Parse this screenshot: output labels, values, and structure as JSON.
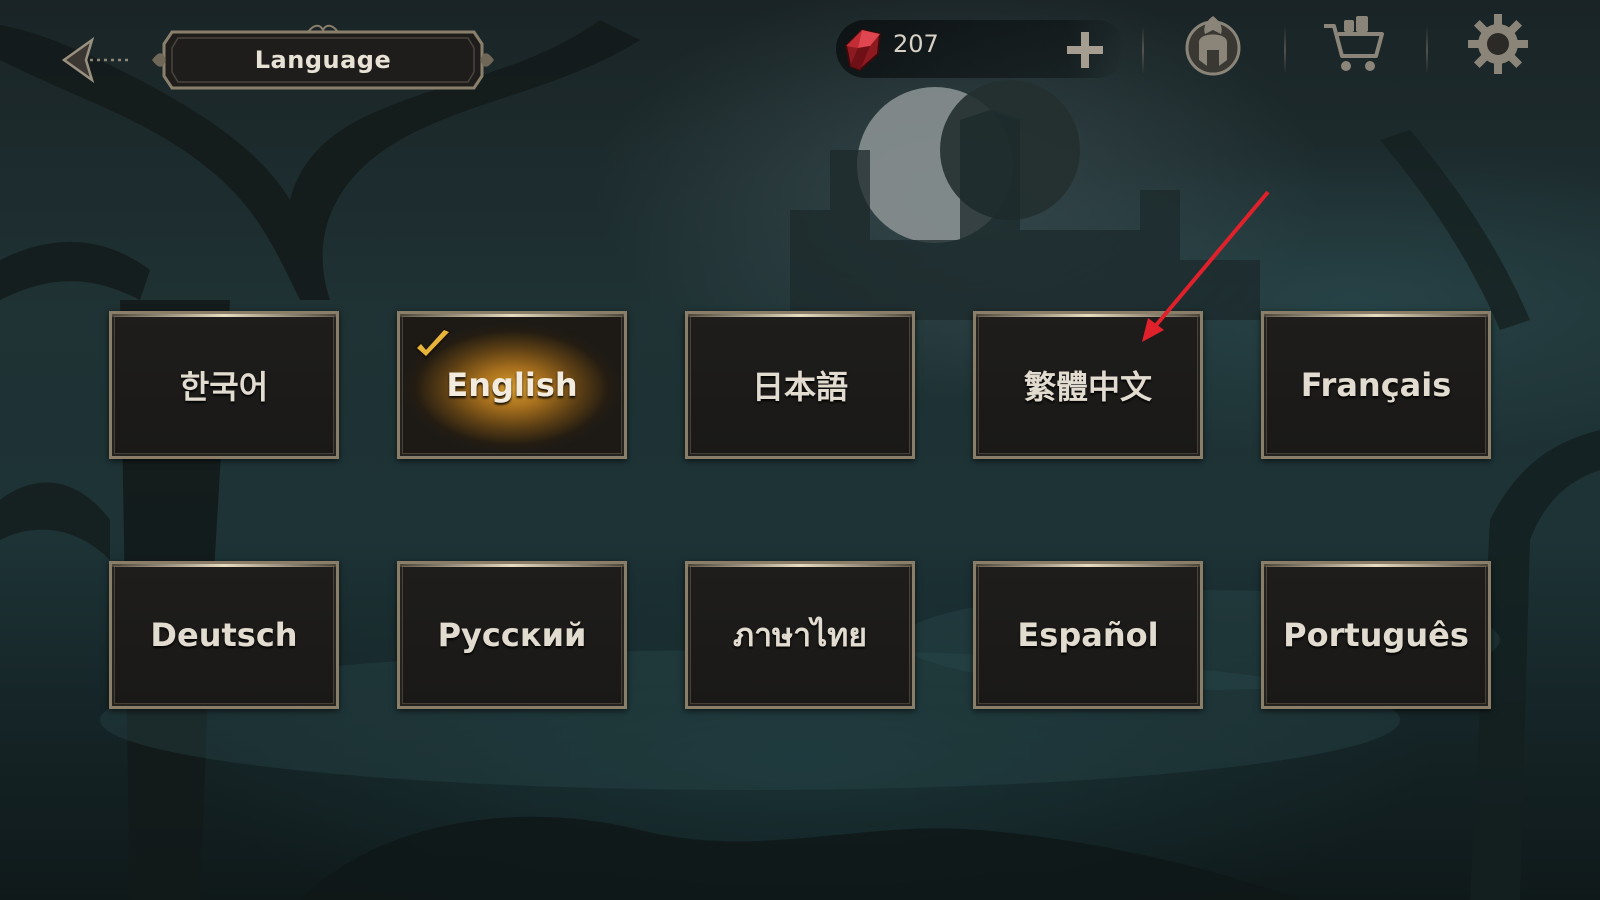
{
  "header": {
    "back_icon": "back-arrow-icon",
    "title": "Language"
  },
  "currency": {
    "icon": "red-gem-icon",
    "amount": "207",
    "add_icon": "plus-icon"
  },
  "toolbar": {
    "icons": [
      "spartan-helmet-icon",
      "shopping-cart-icon",
      "gear-icon"
    ]
  },
  "languages": [
    {
      "label": "한국어",
      "selected": false
    },
    {
      "label": "English",
      "selected": true
    },
    {
      "label": "日本語",
      "selected": false
    },
    {
      "label": "繁體中文",
      "selected": false
    },
    {
      "label": "Français",
      "selected": false
    },
    {
      "label": "Deutsch",
      "selected": false
    },
    {
      "label": "Русский",
      "selected": false
    },
    {
      "label": "ภาษาไทย",
      "selected": false
    },
    {
      "label": "Español",
      "selected": false
    },
    {
      "label": "Português",
      "selected": false
    }
  ],
  "colors": {
    "selected_glow": "#d59b2c",
    "button_border": "#8a7e68",
    "annotation_arrow": "#e0202a"
  }
}
